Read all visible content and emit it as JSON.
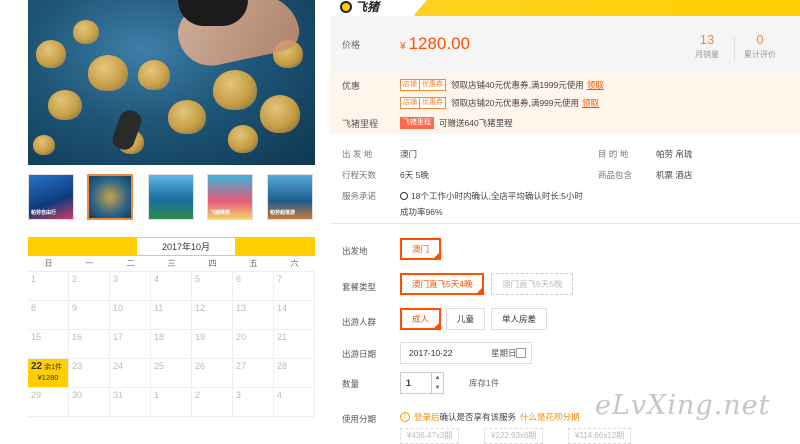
{
  "brand": {
    "logo_text": "飞猪"
  },
  "gallery": {
    "thumbnails": [
      {
        "caption": "帕劳自由行"
      },
      {
        "caption": ""
      },
      {
        "caption": ""
      },
      {
        "caption": "飞猪推荐"
      },
      {
        "caption": "帕劳超值游"
      }
    ]
  },
  "calendar": {
    "month": "2017年10月",
    "weekdays": [
      "日",
      "一",
      "二",
      "三",
      "四",
      "五",
      "六"
    ],
    "rows": [
      [
        "1",
        "2",
        "3",
        "4",
        "5",
        "6",
        "7"
      ],
      [
        "8",
        "9",
        "10",
        "11",
        "12",
        "13",
        "14"
      ],
      [
        "15",
        "16",
        "17",
        "18",
        "19",
        "20",
        "21"
      ],
      [
        "22",
        "23",
        "24",
        "25",
        "26",
        "27",
        "28"
      ],
      [
        "29",
        "30",
        "31",
        "1",
        "2",
        "3",
        "4"
      ]
    ],
    "available": {
      "day": "22",
      "stock": "余1件",
      "price": "¥1280"
    }
  },
  "price": {
    "label": "价格",
    "currency": "¥",
    "value": "1280.00",
    "monthly_sales": "13",
    "monthly_sales_label": "月销量",
    "reviews": "0",
    "reviews_label": "累计评价"
  },
  "promo": {
    "label": "优惠",
    "items": [
      {
        "tag1": "店铺",
        "tag2": "优惠券",
        "text": "领取店铺40元优惠券,满1999元使用",
        "link": "领取"
      },
      {
        "tag1": "店铺",
        "tag2": "优惠券",
        "text": "领取店铺20元优惠券,满999元使用",
        "link": "领取"
      }
    ],
    "mileage_label": "飞猪里程",
    "mileage_tag": "飞猪里程",
    "mileage_text": "可赠送640飞猪里程"
  },
  "info": {
    "departure_label": "出 发 地",
    "departure_value": "澳门",
    "destination_label": "目 的 地",
    "destination_value": "帕劳   帛琉",
    "days_label": "行程天数",
    "days_value": "6天   5晚",
    "includes_label": "商品包含",
    "includes_value": "机票   酒店",
    "promise_label": "服务承诺",
    "promise_line1": "18个工作小时内确认,全店平均确认时长:5小时",
    "promise_line2": "成功率96%"
  },
  "options": {
    "departure_label": "出发地",
    "departure_value": "澳门",
    "package_label": "套餐类型",
    "package_selected": "澳门直飞5天4晚",
    "package_other": "澳门直飞6天5晚",
    "group_label": "出游人群",
    "group_adult": "成人",
    "group_child": "儿童",
    "group_single": "单人房差",
    "date_label": "出游日期",
    "date_value": "2017-10-22",
    "date_weekday": "星期日",
    "qty_label": "数量",
    "qty_value": "1",
    "stock_text": "库存1件",
    "installment_label": "使用分期",
    "installment_warn_link": "登录后",
    "installment_warn_text": "确认是否享有该服务",
    "installment_help": "什么是花呗分期",
    "installments": [
      "¥436.47x3期",
      "¥222.93x6期",
      "¥114.66x12期"
    ]
  },
  "watermark": "eLvXing.net"
}
